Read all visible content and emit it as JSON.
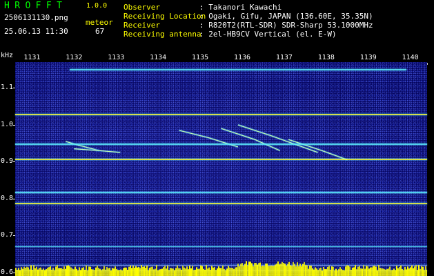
{
  "app": {
    "logo": "HROFFT",
    "version": "1.0.0",
    "filename": "2506131130.png",
    "datetime": "25.06.13 11:30",
    "meteor_label": "meteor",
    "meteor_count": "67"
  },
  "info": [
    {
      "label": "Observer",
      "value": ": Takanori Kawachi"
    },
    {
      "label": "Receiving Location",
      "value": ": Ogaki, Gifu, JAPAN (136.60E, 35.35N)"
    },
    {
      "label": "Receiver",
      "value": ": R820T2(RTL-SDR) SDR-Sharp 53.1000MHz"
    },
    {
      "label": "Receiving antenna",
      "value": ": 2el-HB9CV Vertical (el. E-W)"
    }
  ],
  "axes": {
    "y_unit": "kHz",
    "x_ticks": [
      "1131",
      "1132",
      "1133",
      "1134",
      "1135",
      "1136",
      "1137",
      "1138",
      "1139",
      "1140"
    ],
    "y_ticks": [
      "1.1",
      "1.0",
      "0.9",
      "0.8",
      "0.7",
      "0.6"
    ]
  },
  "colors": {
    "header_yellow": "#ffff00",
    "logo_green": "#00ff00",
    "background_blue": "#050560",
    "signal_cyan": "#5cf0ff",
    "signal_yellow": "#f6ff40",
    "strip_yellow": "#ffff00"
  },
  "chart_data": {
    "type": "heatmap",
    "x_range": [
      1130.6,
      1140.4
    ],
    "y_range": [
      0.59,
      1.17
    ],
    "carriers_khz": [
      1.152,
      1.029,
      0.949,
      0.908,
      0.819,
      0.788,
      0.67,
      0.62,
      0.605
    ],
    "meteor_traces": [
      {
        "x": [
          1131.8,
          1132.1,
          1132.6
        ],
        "y": [
          0.955,
          0.945,
          0.93
        ]
      },
      {
        "x": [
          1132.0,
          1132.6,
          1133.1
        ],
        "y": [
          0.935,
          0.93,
          0.925
        ]
      },
      {
        "x": [
          1134.5,
          1135.2,
          1135.9
        ],
        "y": [
          0.985,
          0.965,
          0.94
        ]
      },
      {
        "x": [
          1135.5,
          1136.3,
          1136.9
        ],
        "y": [
          0.99,
          0.96,
          0.93
        ]
      },
      {
        "x": [
          1135.9,
          1136.7,
          1137.8
        ],
        "y": [
          1.0,
          0.97,
          0.925
        ]
      },
      {
        "x": [
          1137.1,
          1137.9,
          1138.5
        ],
        "y": [
          0.96,
          0.93,
          0.905
        ]
      }
    ]
  }
}
